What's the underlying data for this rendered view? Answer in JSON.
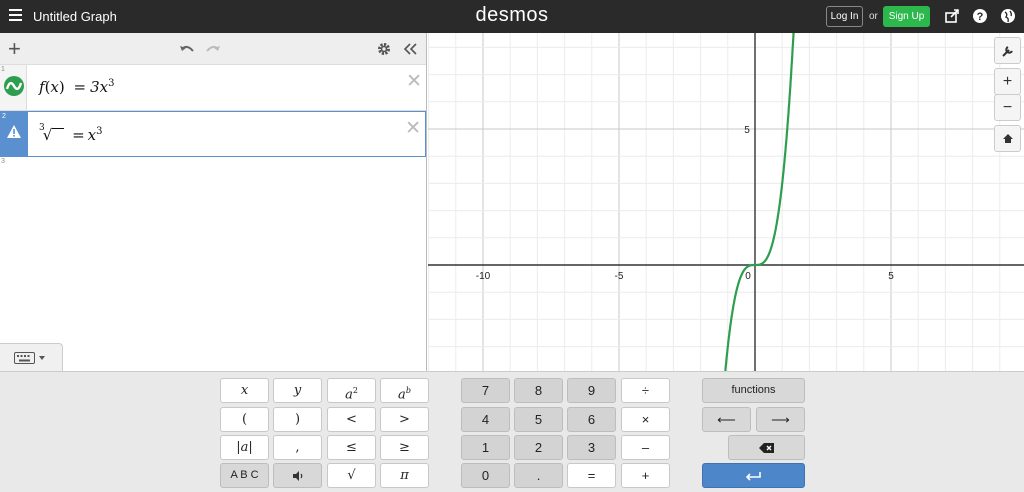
{
  "header": {
    "title": "Untitled Graph",
    "logo": "desmos",
    "login_label": "Log In",
    "or_text": "or",
    "signup_label": "Sign Up",
    "accent": "#2db84d"
  },
  "expressions": [
    {
      "num": "1",
      "lhs": "f",
      "lparen": "(",
      "var": "x",
      "rparen": ")",
      "eq": "=",
      "coef": "3x",
      "exp": "3",
      "color": "#2d9e4f"
    },
    {
      "num": "2",
      "root_index": "3",
      "radical": "√",
      "eq": "=",
      "rhs": "x",
      "exp": "3",
      "status": "warning"
    },
    {
      "num": "3"
    }
  ],
  "graph": {
    "x_ticks": [
      "-10",
      "-5",
      "0",
      "5"
    ],
    "y_ticks": [
      "5"
    ],
    "curve_color": "#2d9e4f"
  },
  "keypad": {
    "left": [
      "x",
      "y",
      "a",
      "2",
      "a",
      "b",
      "(",
      ")",
      "<",
      ">",
      "|a|",
      ",",
      "≤",
      "≥",
      "A B C",
      "√",
      "π"
    ],
    "num": [
      "7",
      "8",
      "9",
      "÷",
      "4",
      "5",
      "6",
      "×",
      "1",
      "2",
      "3",
      "–",
      "0",
      ".",
      "=",
      "+"
    ],
    "functions_label": "functions",
    "left_arrow": "⟵",
    "right_arrow": "⟶"
  }
}
